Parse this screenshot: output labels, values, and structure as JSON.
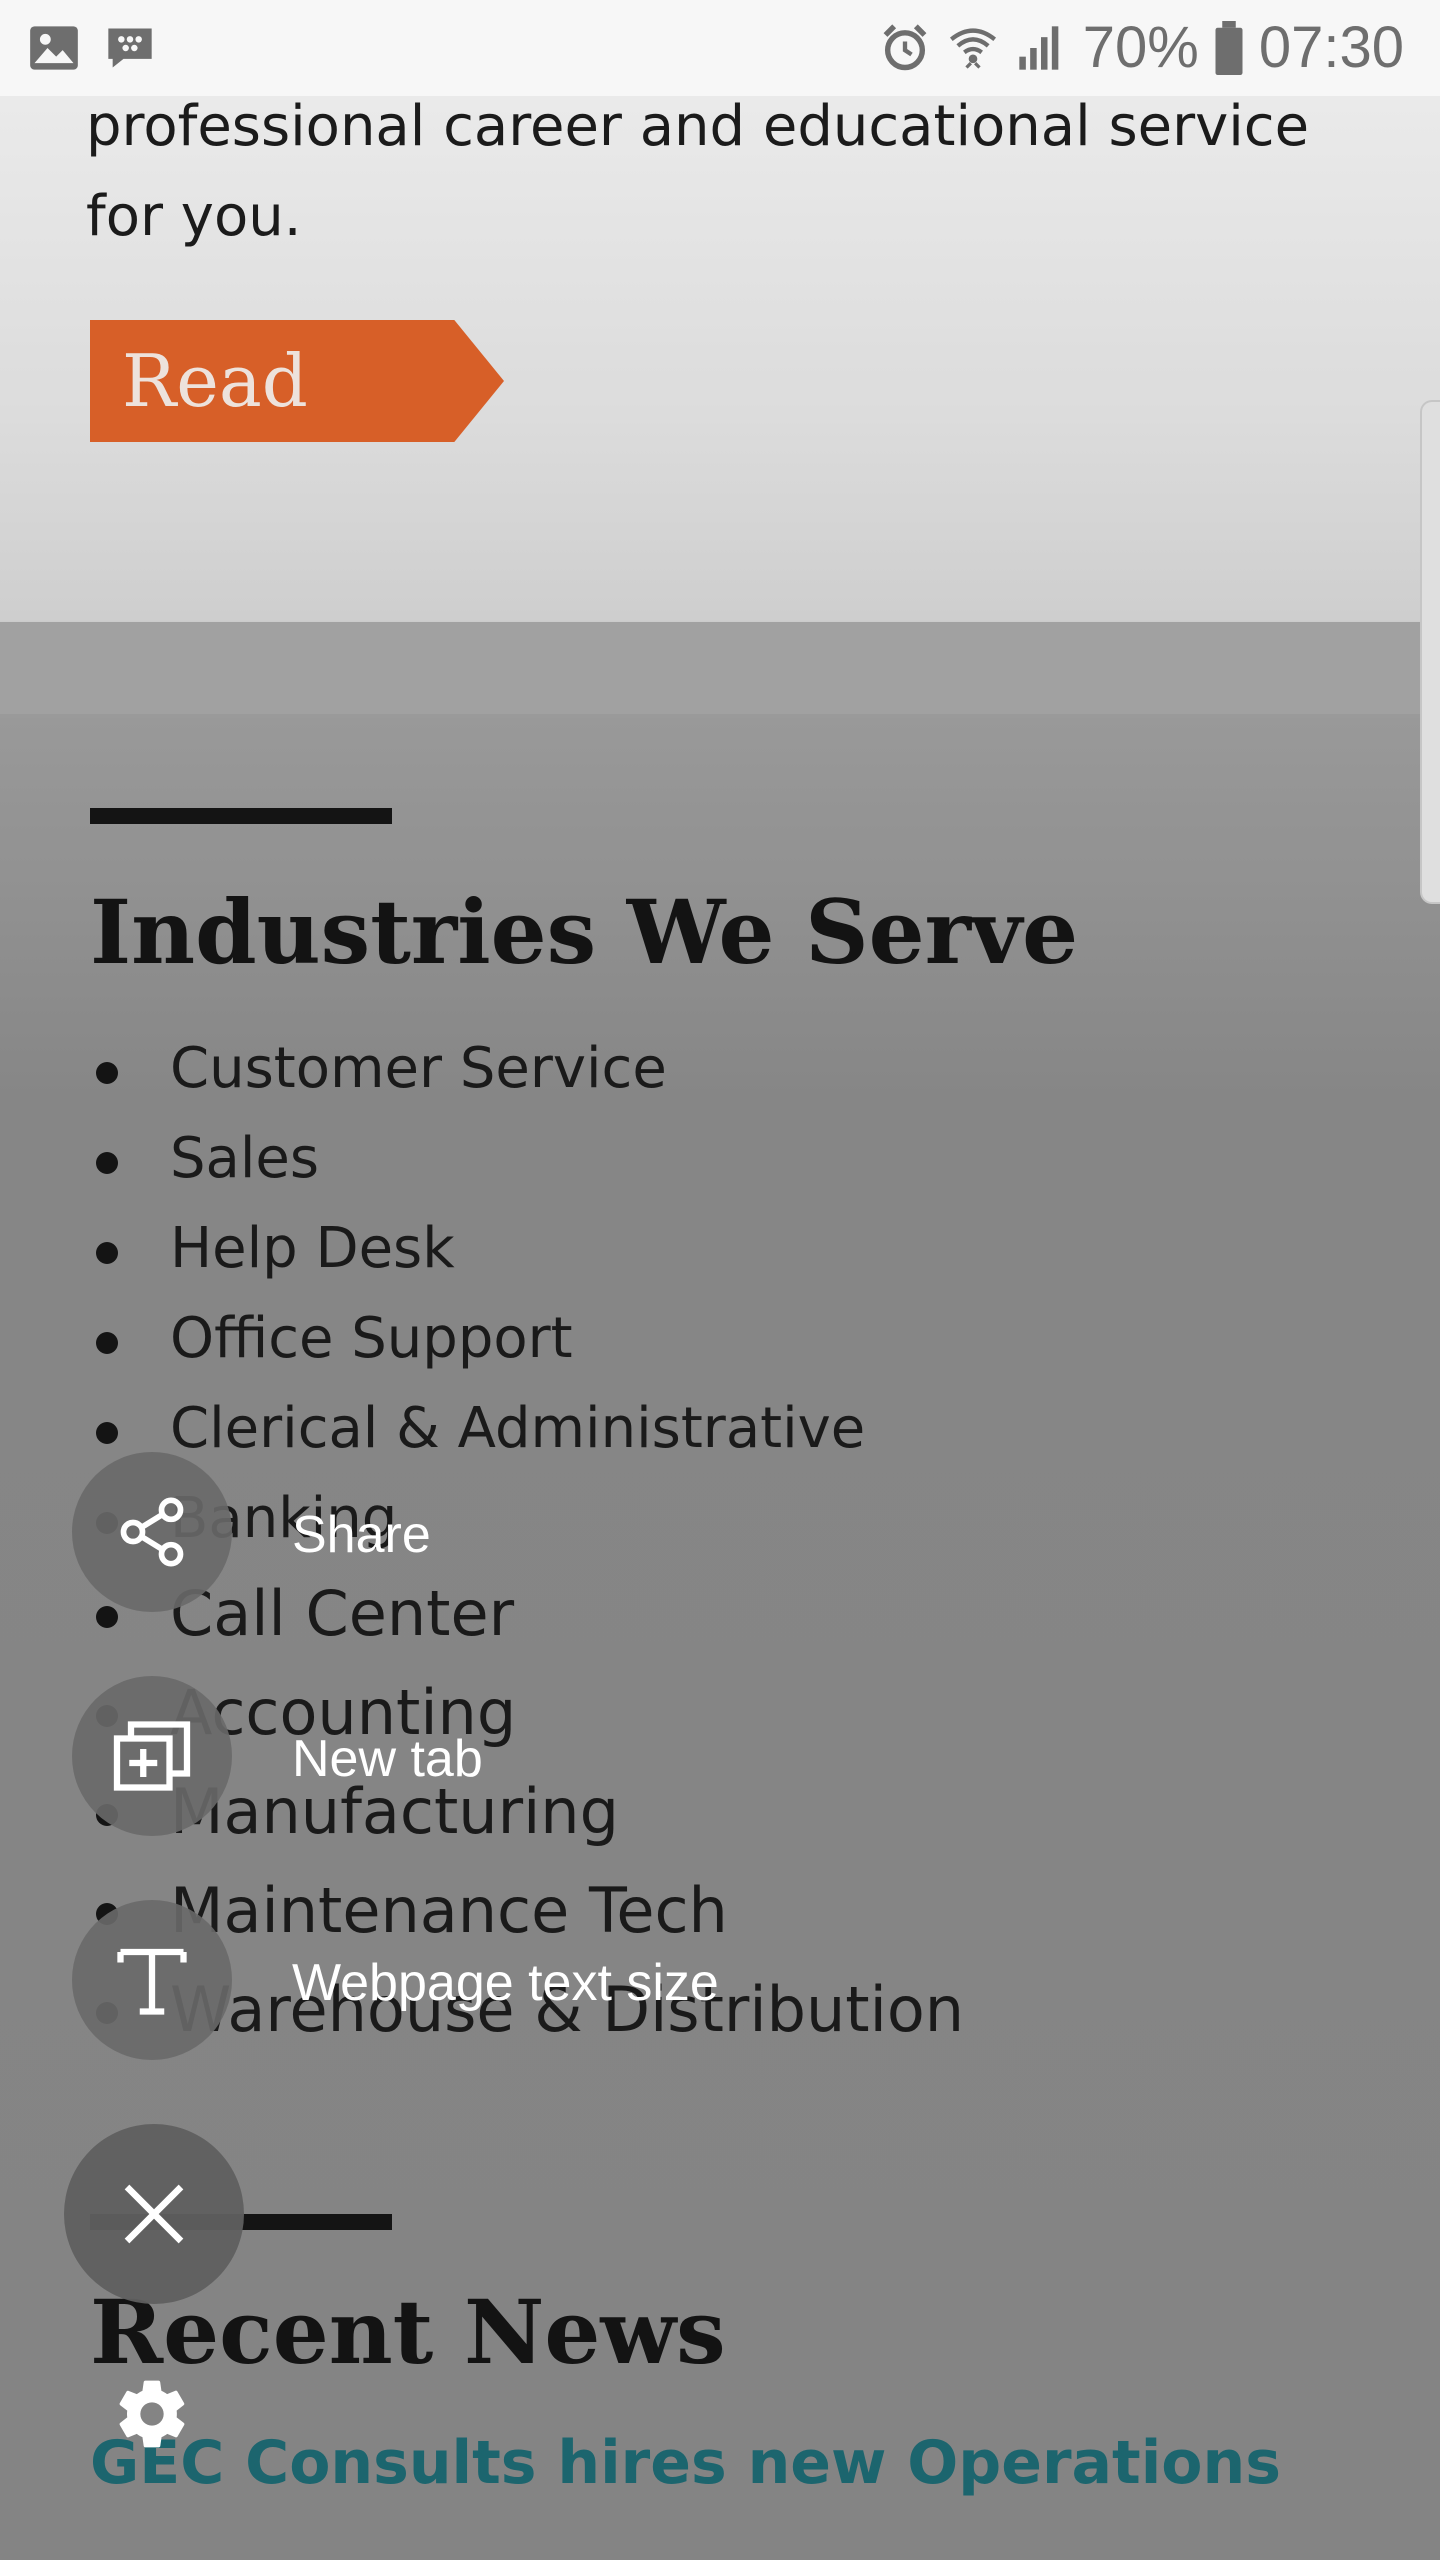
{
  "status_bar": {
    "battery_percent": "70%",
    "time": "07:30",
    "icons": [
      "gallery-icon",
      "blackberry-messenger-icon",
      "alarm-icon",
      "wifi-icon",
      "signal-icon",
      "battery-icon"
    ]
  },
  "intro": {
    "text": "professional career and educational service for you.",
    "read_more_label": "Read More"
  },
  "industries": {
    "heading": "Industries We Serve",
    "items": [
      "Customer Service",
      "Sales",
      "Help Desk",
      "Office Support",
      "Clerical & Administrative",
      "Banking",
      "Call Center",
      "Accounting",
      "Manufacturing",
      "Maintenance Tech",
      "Warehouse & Distribution"
    ]
  },
  "news": {
    "heading": "Recent News",
    "link_text": "GEC Consults hires new Operations"
  },
  "fab_menu": {
    "share_label": "Share",
    "new_tab_label": "New tab",
    "text_size_label": "Webpage text size"
  },
  "colors": {
    "accent_orange": "#e0632a",
    "link_teal": "#1e6a73"
  }
}
